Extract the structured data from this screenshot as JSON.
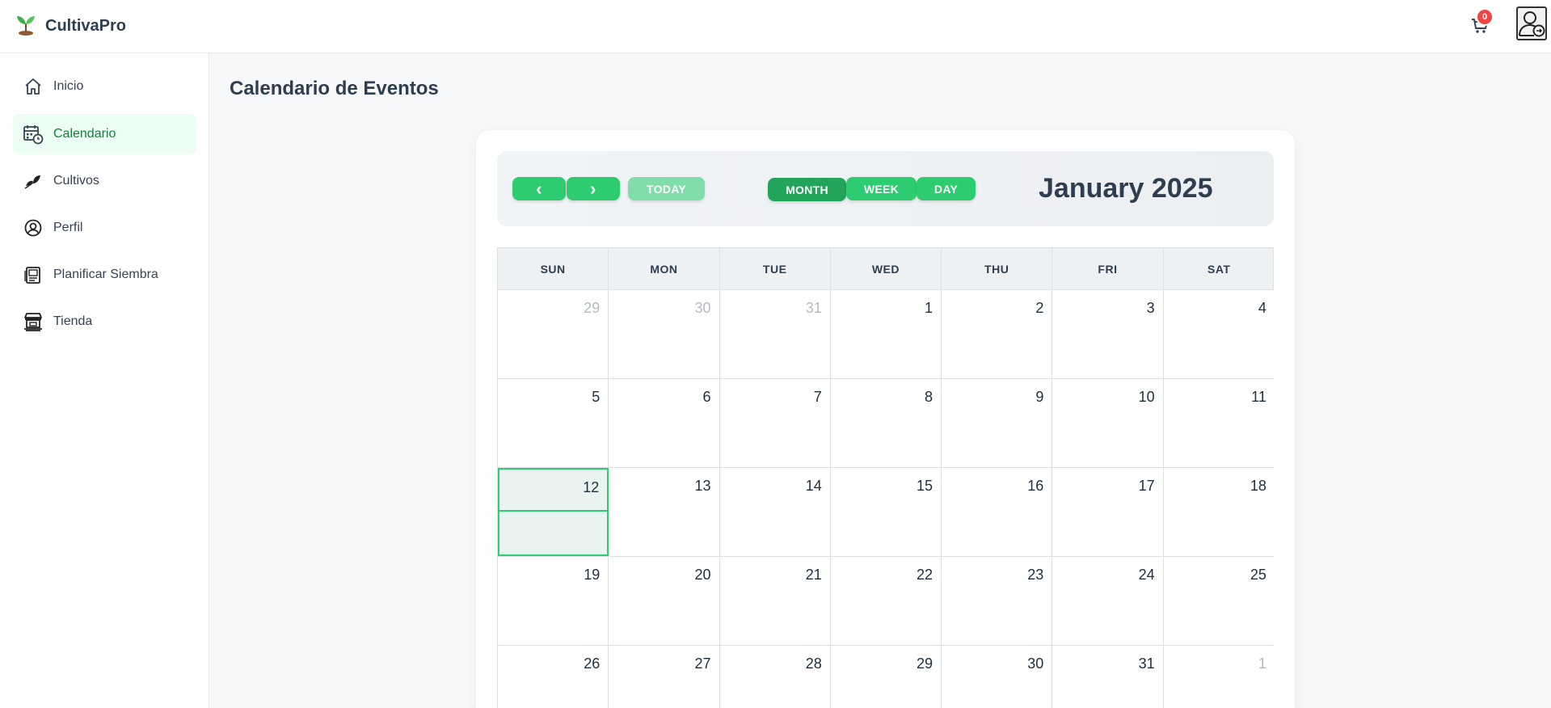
{
  "app": {
    "name": "CultivaPro"
  },
  "header": {
    "cart_count": "0"
  },
  "sidebar": {
    "items": [
      {
        "label": "Inicio",
        "icon": "home-icon"
      },
      {
        "label": "Calendario",
        "icon": "calendar-icon",
        "active": true
      },
      {
        "label": "Cultivos",
        "icon": "leaf-icon"
      },
      {
        "label": "Perfil",
        "icon": "user-circle-icon"
      },
      {
        "label": "Planificar Siembra",
        "icon": "plan-document-icon"
      },
      {
        "label": "Tienda",
        "icon": "store-icon"
      }
    ]
  },
  "main": {
    "title": "Calendario de Eventos"
  },
  "calendar": {
    "prev_label": "‹",
    "next_label": "›",
    "today_label": "TODAY",
    "views": [
      "MONTH",
      "WEEK",
      "DAY"
    ],
    "active_view": "MONTH",
    "month_title": "January 2025",
    "weekdays": [
      "SUN",
      "MON",
      "TUE",
      "WED",
      "THU",
      "FRI",
      "SAT"
    ],
    "weeks": [
      [
        "29",
        "30",
        "31",
        "1",
        "2",
        "3",
        "4"
      ],
      [
        "5",
        "6",
        "7",
        "8",
        "9",
        "10",
        "11"
      ],
      [
        "12",
        "13",
        "14",
        "15",
        "16",
        "17",
        "18"
      ],
      [
        "19",
        "20",
        "21",
        "22",
        "23",
        "24",
        "25"
      ],
      [
        "26",
        "27",
        "28",
        "29",
        "30",
        "31",
        "1"
      ]
    ],
    "muted_cells": [
      [
        0,
        0
      ],
      [
        0,
        1
      ],
      [
        0,
        2
      ],
      [
        4,
        6
      ]
    ],
    "today_cell": [
      2,
      0
    ]
  },
  "colors": {
    "accent": "#2ecc71",
    "accent_dark": "#22a45b",
    "active_nav_bg": "#ecfdf3",
    "badge": "#ef4444"
  }
}
